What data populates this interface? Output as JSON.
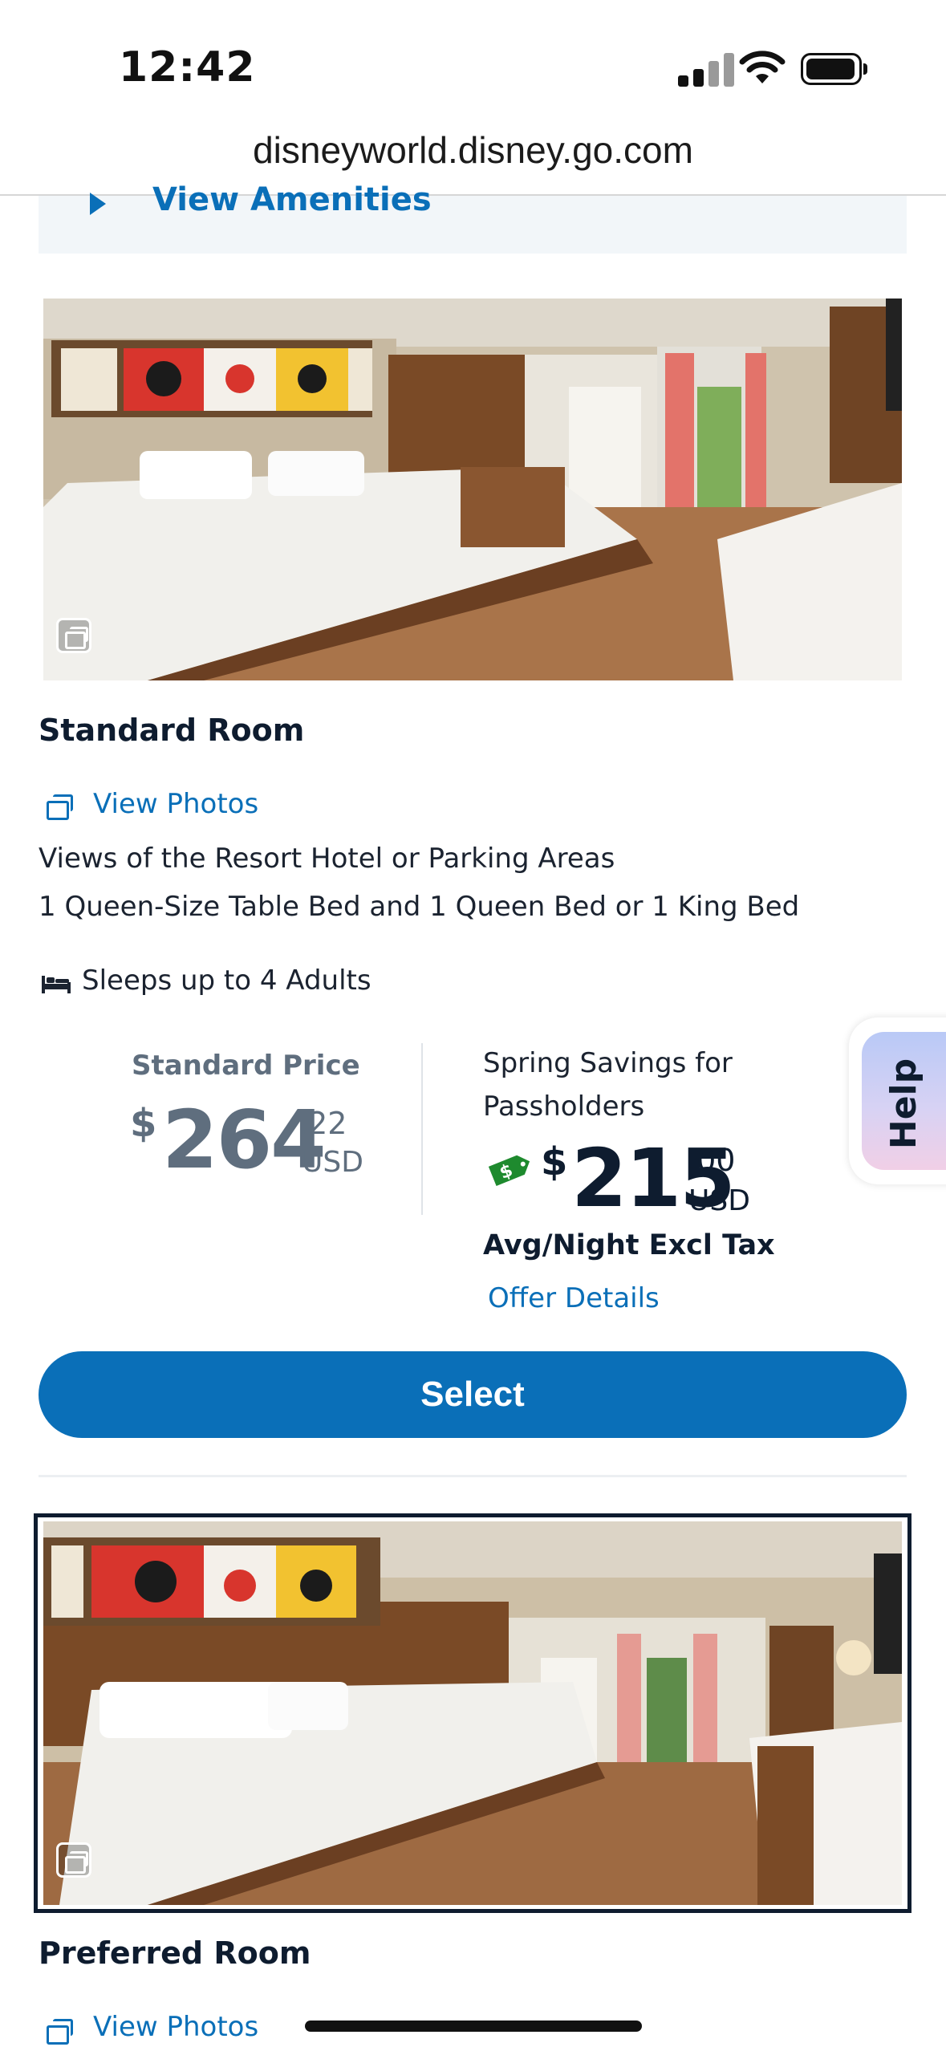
{
  "status_bar": {
    "time": "12:42"
  },
  "browser": {
    "url": "disneyworld.disney.go.com"
  },
  "amenities": {
    "label": "View Amenities"
  },
  "rooms": [
    {
      "title": "Standard Room",
      "view_photos": "View Photos",
      "view": "Views of the Resort Hotel or Parking Areas",
      "beds": "1 Queen-Size Table Bed and 1 Queen Bed or 1 King Bed",
      "sleeps": "Sleeps up to 4 Adults",
      "standard_price": {
        "label": "Standard Price",
        "currency_symbol": "$",
        "dollars": "264",
        "cents": ".22",
        "currency": "USD"
      },
      "offer_price": {
        "label_line1": "Spring Savings for",
        "label_line2": "Passholders",
        "currency_symbol": "$",
        "dollars": "215",
        "cents": ".00",
        "currency": "USD",
        "note": "Avg/Night Excl Tax",
        "details_link": "Offer Details"
      },
      "select_label": "Select"
    },
    {
      "title": "Preferred Room",
      "view_photos": "View Photos"
    }
  ],
  "help": {
    "label": "Help"
  },
  "colors": {
    "accent": "#0a6fb8",
    "dark_text": "#0e1c2f",
    "grey_price": "#5f6e7e",
    "promo_tag": "#1e8a2e"
  }
}
